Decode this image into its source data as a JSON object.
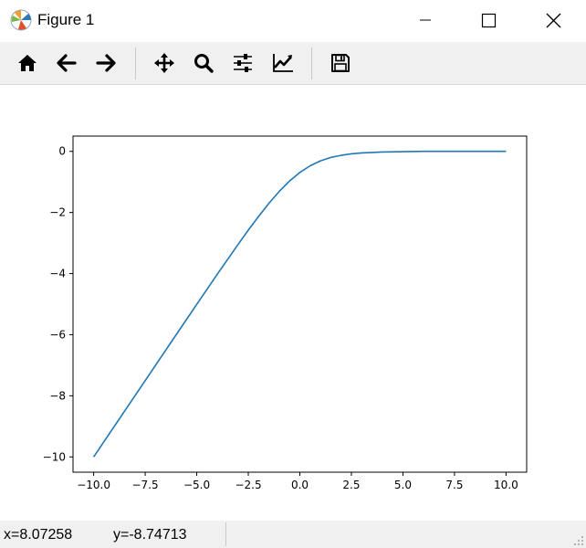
{
  "window": {
    "title": "Figure 1",
    "controls": [
      "minimize-icon",
      "maximize-icon",
      "close-icon"
    ]
  },
  "toolbar": {
    "buttons": [
      {
        "name": "home",
        "icon": "home-icon"
      },
      {
        "name": "back",
        "icon": "arrow-left-icon"
      },
      {
        "name": "forward",
        "icon": "arrow-right-icon"
      },
      {
        "name": "pan",
        "icon": "move-icon"
      },
      {
        "name": "zoom",
        "icon": "search-icon"
      },
      {
        "name": "configure-subplots",
        "icon": "sliders-icon"
      },
      {
        "name": "edit-axis",
        "icon": "line-chart-icon"
      },
      {
        "name": "save",
        "icon": "save-icon"
      }
    ]
  },
  "status": {
    "x_readout": "x=8.07258",
    "y_readout": "y=-8.74713"
  },
  "colors": {
    "line": "#1f77b4",
    "toolbar_bg": "#f0f0f0"
  },
  "chart_data": {
    "type": "line",
    "title": "",
    "xlabel": "",
    "ylabel": "",
    "xlim": [
      -11.0,
      11.0
    ],
    "ylim": [
      -10.5,
      0.5
    ],
    "xticks": [
      -10.0,
      -7.5,
      -5.0,
      -2.5,
      0.0,
      2.5,
      5.0,
      7.5,
      10.0
    ],
    "xtick_labels": [
      "−10.0",
      "−7.5",
      "−5.0",
      "−2.5",
      "0.0",
      "2.5",
      "5.0",
      "7.5",
      "10.0"
    ],
    "yticks": [
      0,
      -2,
      -4,
      -6,
      -8,
      -10
    ],
    "ytick_labels": [
      "0",
      "−2",
      "−4",
      "−6",
      "−8",
      "−10"
    ],
    "grid": false,
    "legend": false,
    "series": [
      {
        "x": [
          -10,
          -9,
          -8,
          -7,
          -6,
          -5,
          -4,
          -3,
          -2.5,
          -2,
          -1.5,
          -1,
          -0.5,
          0,
          0.5,
          1,
          1.5,
          2,
          2.5,
          3,
          4,
          5,
          6,
          7,
          8,
          9,
          10
        ],
        "y": [
          -10.0,
          -9.0,
          -8.0,
          -7.0,
          -6.0,
          -5.01,
          -4.02,
          -3.05,
          -2.58,
          -2.13,
          -1.7,
          -1.31,
          -0.97,
          -0.69,
          -0.47,
          -0.31,
          -0.2,
          -0.13,
          -0.08,
          -0.05,
          -0.02,
          -0.01,
          0.0,
          0.0,
          0.0,
          0.0,
          0.0
        ]
      }
    ]
  }
}
